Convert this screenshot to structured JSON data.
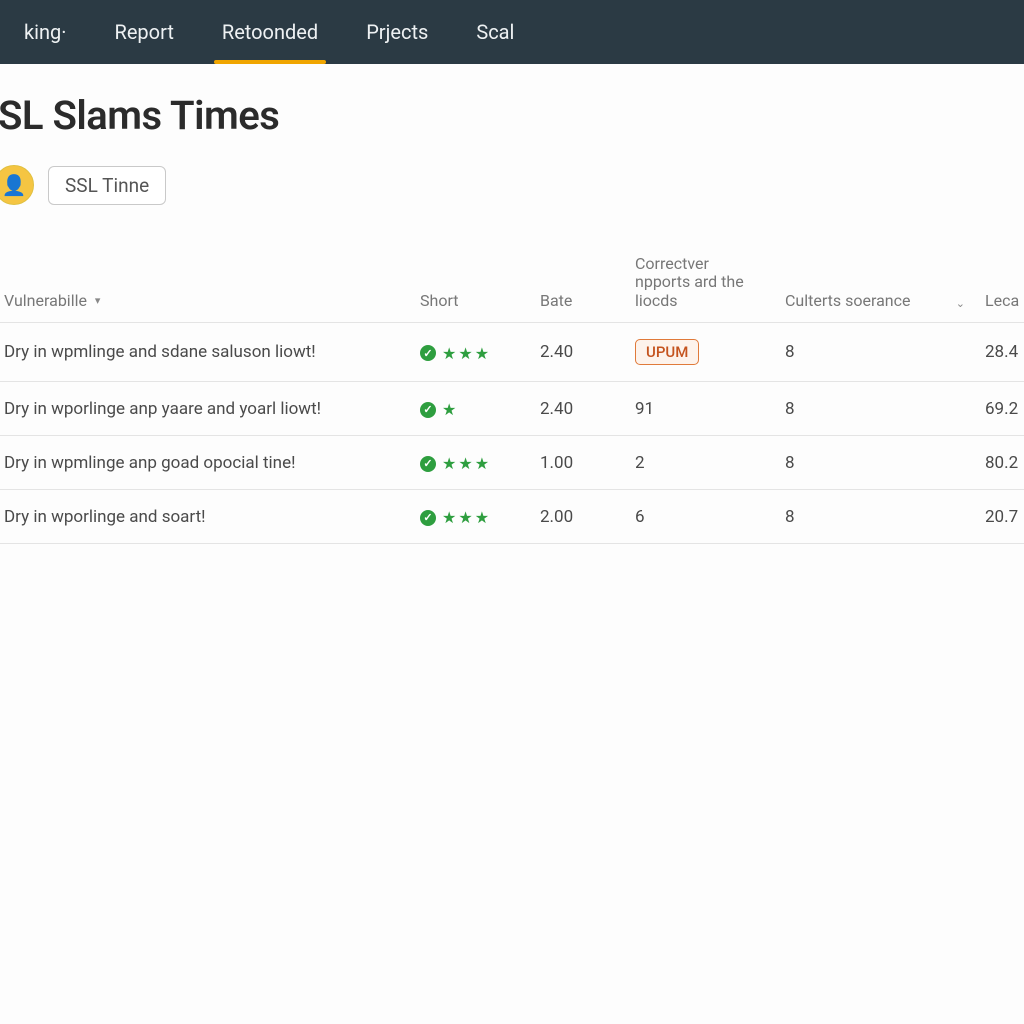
{
  "nav": {
    "items": [
      {
        "label": "king·"
      },
      {
        "label": "Report"
      },
      {
        "label": "Retoonded",
        "active": true
      },
      {
        "label": "Prjects"
      },
      {
        "label": "Scal"
      }
    ]
  },
  "header": {
    "title": "SL Slams Times",
    "chip_label": "SSL Tinne"
  },
  "table": {
    "columns": {
      "vulnerability": "Vulnerabille",
      "short": "Short",
      "bate": "Bate",
      "connective": "Correctver npports ard the liocds",
      "culberts": "Culterts soerance",
      "local": "Leca"
    },
    "rows": [
      {
        "vuln": "Dry in wpmlinge and sdane saluson liowt!",
        "stars": 3,
        "bate": "2.40",
        "connective": "UPUM",
        "connective_badge": true,
        "culberts": "8",
        "local": "28.4"
      },
      {
        "vuln": "Dry in wporlinge anp yaare and yoarl liowt!",
        "stars": 1,
        "bate": "2.40",
        "connective": "91",
        "connective_badge": false,
        "culberts": "8",
        "local": "69.2"
      },
      {
        "vuln": "Dry in wpmlinge anp goad opocial tine!",
        "stars": 3,
        "bate": "1.00",
        "connective": "2",
        "connective_badge": false,
        "culberts": "8",
        "local": "80.2"
      },
      {
        "vuln": "Dry in wporlinge and soart!",
        "stars": 3,
        "bate": "2.00",
        "connective": "6",
        "connective_badge": false,
        "culberts": "8",
        "local": "20.7"
      }
    ]
  }
}
